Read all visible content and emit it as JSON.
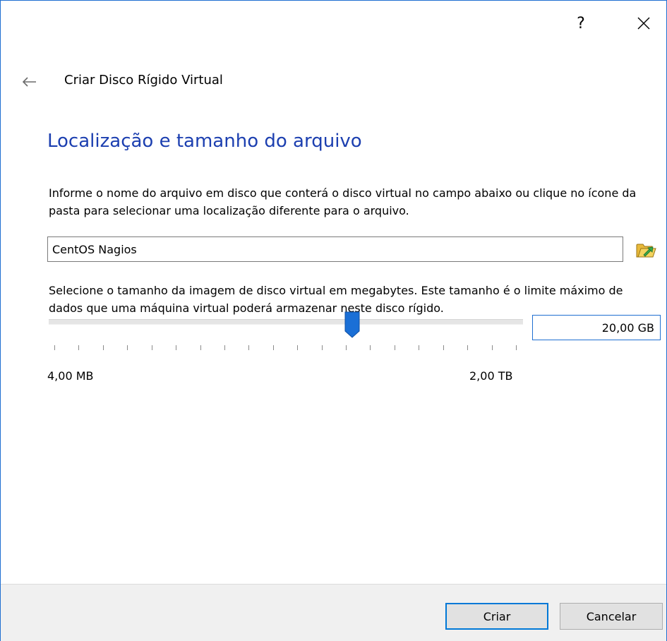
{
  "titlebar": {
    "help_label": "?"
  },
  "header": {
    "title": "Criar Disco Rígido Virtual"
  },
  "page": {
    "heading": "Localização e tamanho do arquivo",
    "file_description": "Informe o nome do arquivo em disco que conterá o disco virtual no campo abaixo ou clique no ícone da pasta para selecionar uma localização diferente para o arquivo.",
    "file_name_value": "CentOS Nagios",
    "size_description": "Selecione o tamanho da imagem de disco virtual em megabytes. Este tamanho é o limite máximo de dados que uma máquina virtual poderá armazenar neste disco rígido.",
    "size_value": "20,00 GB",
    "slider": {
      "min_label": "4,00 MB",
      "max_label": "2,00 TB",
      "position_fraction": 0.64
    }
  },
  "footer": {
    "create_label": "Criar",
    "cancel_label": "Cancelar"
  },
  "icons": {
    "back": "arrow-left-icon",
    "close": "close-icon",
    "folder": "folder-icon"
  },
  "colors": {
    "heading": "#1c3fb0",
    "accent": "#0078d7",
    "slider_thumb": "#1a6fd6",
    "footer_bg": "#f0f0f0"
  }
}
